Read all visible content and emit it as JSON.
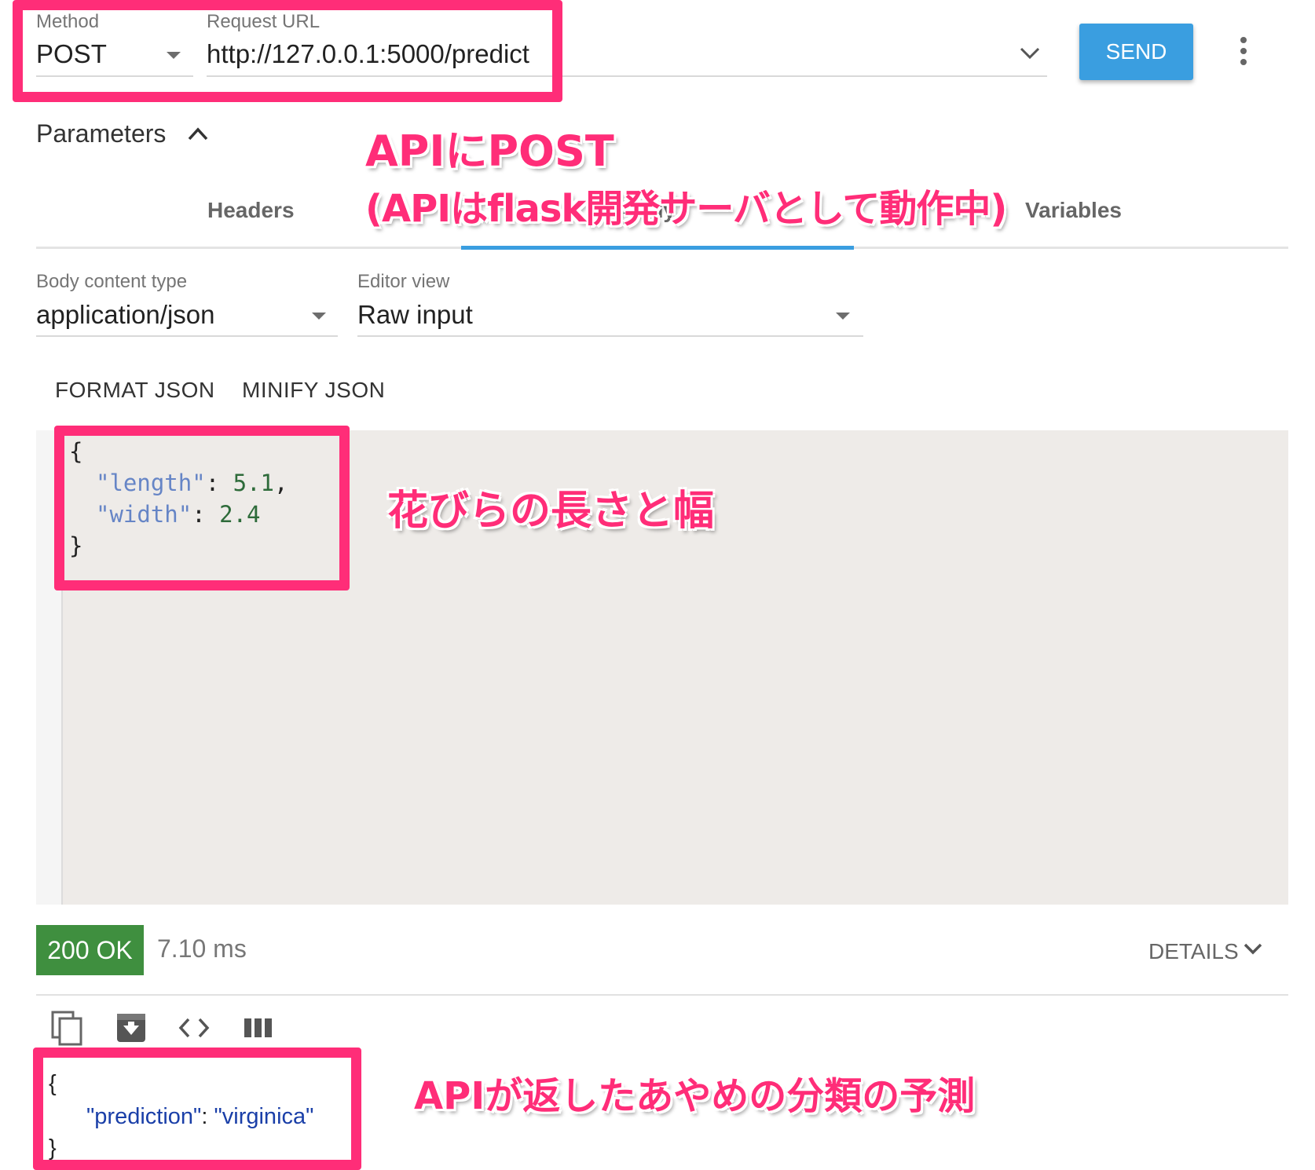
{
  "request": {
    "method_label": "Method",
    "method_value": "POST",
    "url_label": "Request URL",
    "url_value": "http://127.0.0.1:5000/predict",
    "send_label": "SEND"
  },
  "parameters": {
    "title": "Parameters",
    "tabs": [
      "Headers",
      "Body",
      "Variables"
    ],
    "active_tab": 1
  },
  "body": {
    "content_type_label": "Body content type",
    "content_type_value": "application/json",
    "editor_view_label": "Editor view",
    "editor_view_value": "Raw input",
    "format_label": "FORMAT JSON",
    "minify_label": "MINIFY JSON",
    "code": {
      "open": "{",
      "line1_key": "\"length\"",
      "line1_value": "5.1",
      "line2_key": "\"width\"",
      "line2_value": "2.4",
      "close": "}"
    }
  },
  "response": {
    "status": "200 OK",
    "time": "7.10 ms",
    "details_label": "DETAILS",
    "json": {
      "open": "{",
      "key": "\"prediction\"",
      "value": "\"virginica\"",
      "close": "}"
    }
  },
  "annotations": {
    "post_title": "APIにPOST",
    "post_sub": "(APIはflask開発サーバとして動作中)",
    "petal": "花びらの長さと幅",
    "prediction": "APIが返したあやめの分類の予測"
  },
  "colors": {
    "annotation": "#ff2d78",
    "accent": "#3a9ee0",
    "status_ok": "#3f8f3f"
  },
  "icons": [
    "chevron-down-icon",
    "more-vert-icon",
    "chevron-up-icon",
    "copy-icon",
    "save-icon",
    "code-icon",
    "columns-icon"
  ]
}
